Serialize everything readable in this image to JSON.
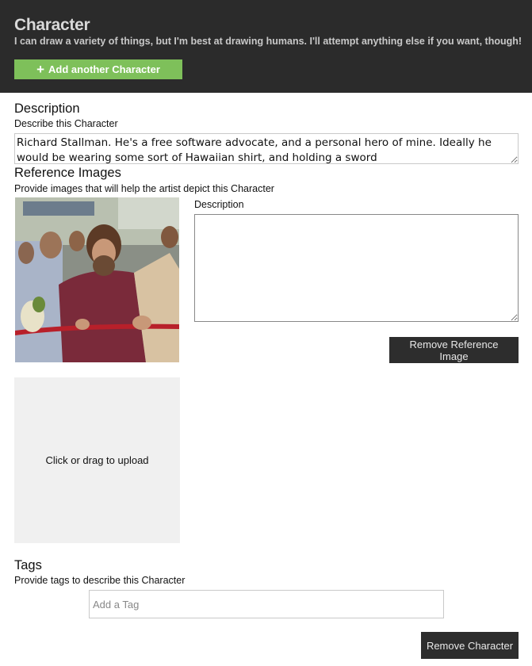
{
  "header": {
    "title": "Character",
    "subtitle": "I can draw a variety of things, but I'm best at drawing humans. I'll attempt anything else if you want, though!",
    "add_button_label": "Add another Character",
    "add_button_icon": "plus-icon",
    "add_button_color": "#7ec05a",
    "background_color": "#2b2b2b"
  },
  "description": {
    "title": "Description",
    "hint": "Describe this Character",
    "value": "Richard Stallman. He's a free software advocate, and a personal hero of mine. Ideally he would be wearing some sort of Hawaiian shirt, and holding a sword"
  },
  "reference_images": {
    "title": "Reference Images",
    "hint": "Provide images that will help the artist depict this Character",
    "items": [
      {
        "description_label": "Description",
        "description_value": "",
        "remove_label": "Remove Reference Image"
      }
    ],
    "upload_label": "Click or drag to upload"
  },
  "tags": {
    "title": "Tags",
    "hint": "Provide tags to describe this Character",
    "placeholder": "Add a Tag"
  },
  "footer": {
    "remove_character_label": "Remove Character"
  }
}
